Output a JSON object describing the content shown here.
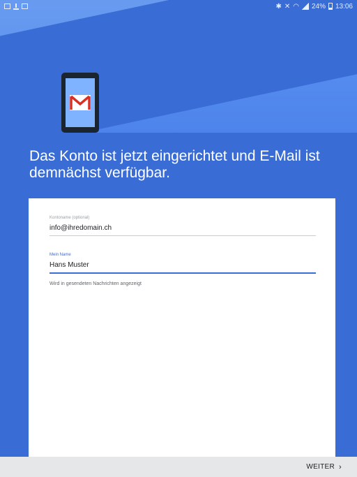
{
  "status_bar": {
    "left_icons": [
      "image-icon",
      "download-icon",
      "image-icon"
    ],
    "right_icons": [
      "bluetooth-icon",
      "mute-icon",
      "wifi-icon",
      "signal-icon"
    ],
    "battery": "24%",
    "time": "13:06"
  },
  "hero": {
    "illustration": "gmail-device-icon",
    "headline": "Das Konto ist jetzt eingerichtet und E-Mail ist demnächst verfügbar."
  },
  "form": {
    "account_label": "Kontoname (optional)",
    "account_value": "info@ihredomain.ch",
    "name_label": "Mein Name",
    "name_value": "Hans Muster",
    "helper": "Wird in gesendeten Nachrichten angezeigt"
  },
  "footer": {
    "next_label": "WEITER",
    "next_icon": "chevron-right-icon"
  },
  "colors": {
    "accent": "#3a6cd6",
    "background": "#3a6cd6",
    "card": "#ffffff",
    "footer": "#e6e7e8"
  }
}
